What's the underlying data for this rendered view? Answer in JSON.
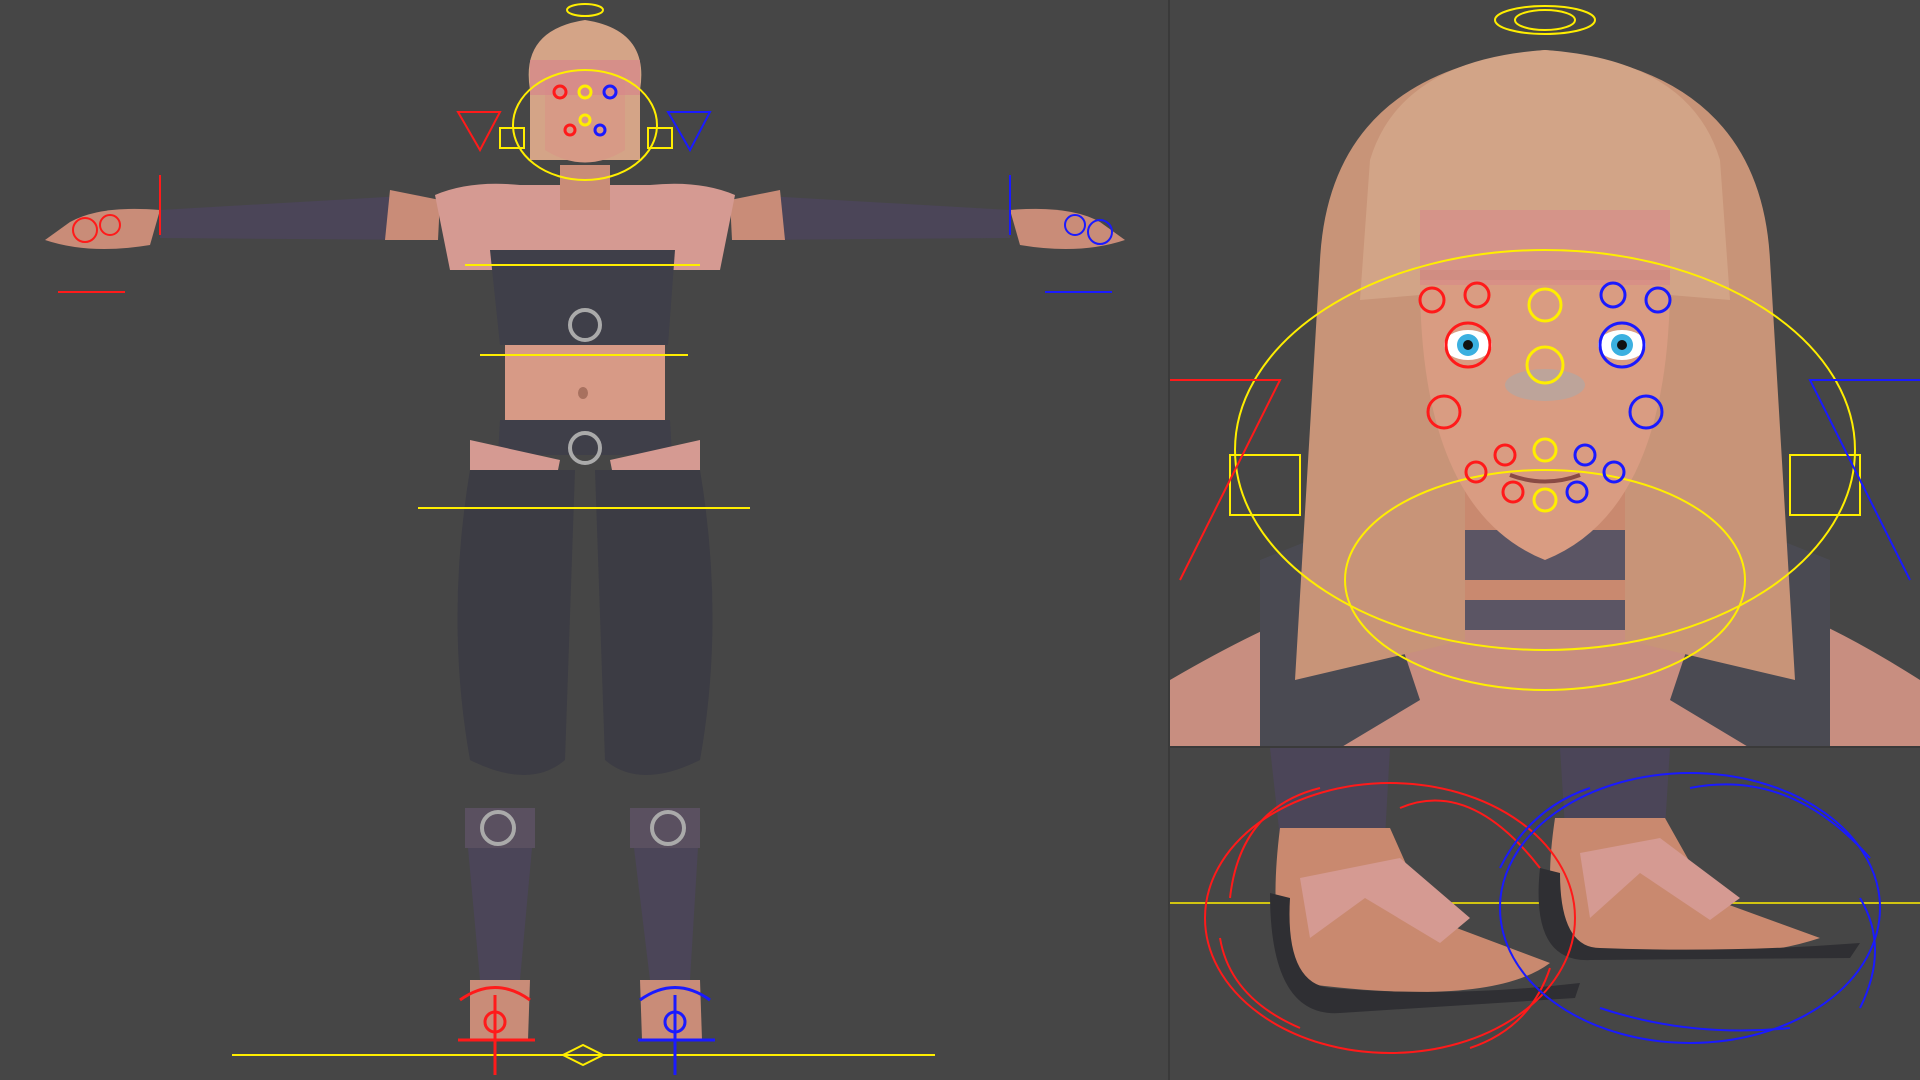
{
  "app": {
    "type": "3D character rig viewport (front views)",
    "background_color": "#464646"
  },
  "viewports": [
    {
      "id": "full-body",
      "label": ""
    },
    {
      "id": "face-closeup",
      "label": ""
    },
    {
      "id": "feet-closeup",
      "label": ""
    }
  ],
  "colors": {
    "control_left": "#ff1a1a",
    "control_right": "#1a1aff",
    "control_center": "#ffee00",
    "skin": "#d79a86",
    "skin_shadow": "#a8715f",
    "cloth_dark": "#3f3f49",
    "cloth_wrap": "#4b4558",
    "cloth_pink": "#d59a92",
    "hair_light": "#d4a487",
    "hair_pink": "#d7868a",
    "hair_dark": "#8a6a52"
  },
  "icons": {
    "head_control": "halo-icon",
    "root_control": "root-ctrl-icon",
    "foot_control_left": "foot-ik-icon",
    "foot_control_right": "foot-ik-icon"
  }
}
